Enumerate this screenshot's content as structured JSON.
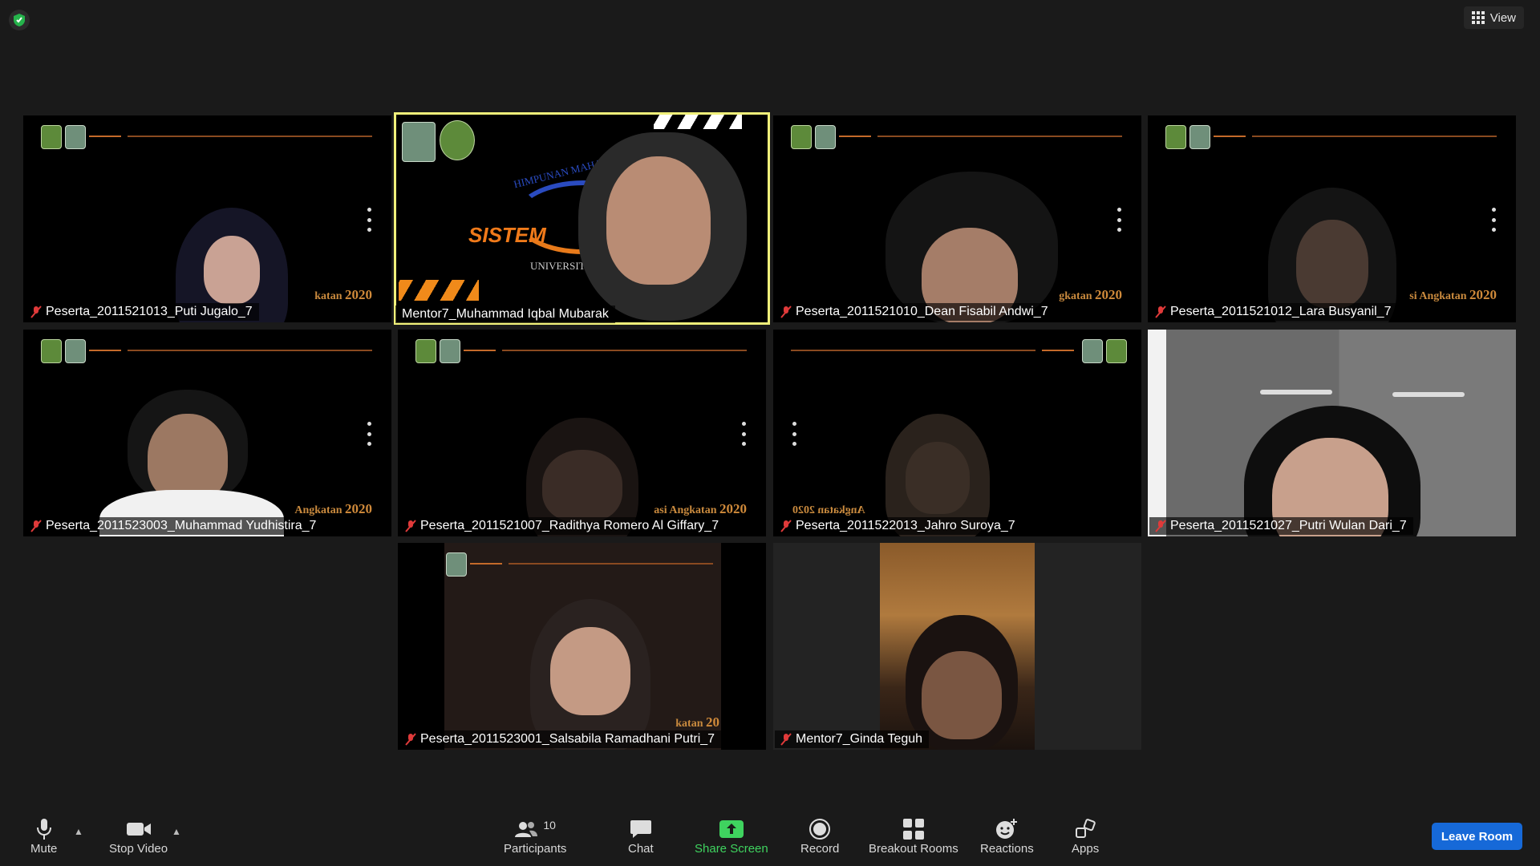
{
  "top_bar": {
    "view_label": "View"
  },
  "tiles": [
    {
      "name": "Peserta_2011521013_Puti Jugalo_7",
      "muted": true
    },
    {
      "name": "Mentor7_Muhammad Iqbal Mubarak",
      "muted": false,
      "active": true
    },
    {
      "name": "Peserta_2011521010_Dean Fisabil Andwi_7",
      "muted": true
    },
    {
      "name": "Peserta_2011521012_Lara Busyanil_7",
      "muted": true
    },
    {
      "name": "Peserta_2011523003_Muhammad Yudhistira_7",
      "muted": true
    },
    {
      "name": "Peserta_2011521007_Radithya Romero Al Giffary_7",
      "muted": true
    },
    {
      "name": "Peserta_2011522013_Jahro Suroya_7",
      "muted": true
    },
    {
      "name": "Peserta_2011521027_Putri Wulan Dari_7",
      "muted": true
    },
    {
      "name": "Peserta_2011523001_Salsabila Ramadhani Putri_7",
      "muted": true
    },
    {
      "name": "Mentor7_Ginda Teguh",
      "muted": true
    }
  ],
  "background_text": {
    "angkatan_1": "katan",
    "angkatan_2": "gkatan",
    "angkatan_3": "si Angkatan",
    "angkatan_4": "Angkatan",
    "angkatan_5": "asi Angkatan",
    "angkatan_6": "Angkatan 2020",
    "angkatan_7": "katan",
    "year": "2020",
    "year_short": "20",
    "himpunan": "HIMPUNAN MAHAS",
    "sistem": "SISTEM",
    "universitas": "UNIVERSITAS"
  },
  "toolbar": {
    "mute_label": "Mute",
    "stop_video_label": "Stop Video",
    "participants_label": "Participants",
    "participants_count": "10",
    "chat_label": "Chat",
    "share_screen_label": "Share Screen",
    "record_label": "Record",
    "breakout_rooms_label": "Breakout Rooms",
    "reactions_label": "Reactions",
    "apps_label": "Apps",
    "leave_label": "Leave Room"
  },
  "colors": {
    "accent_active": "#f0f07a",
    "share_green": "#3fd35f",
    "leave_blue": "#1669d8"
  }
}
